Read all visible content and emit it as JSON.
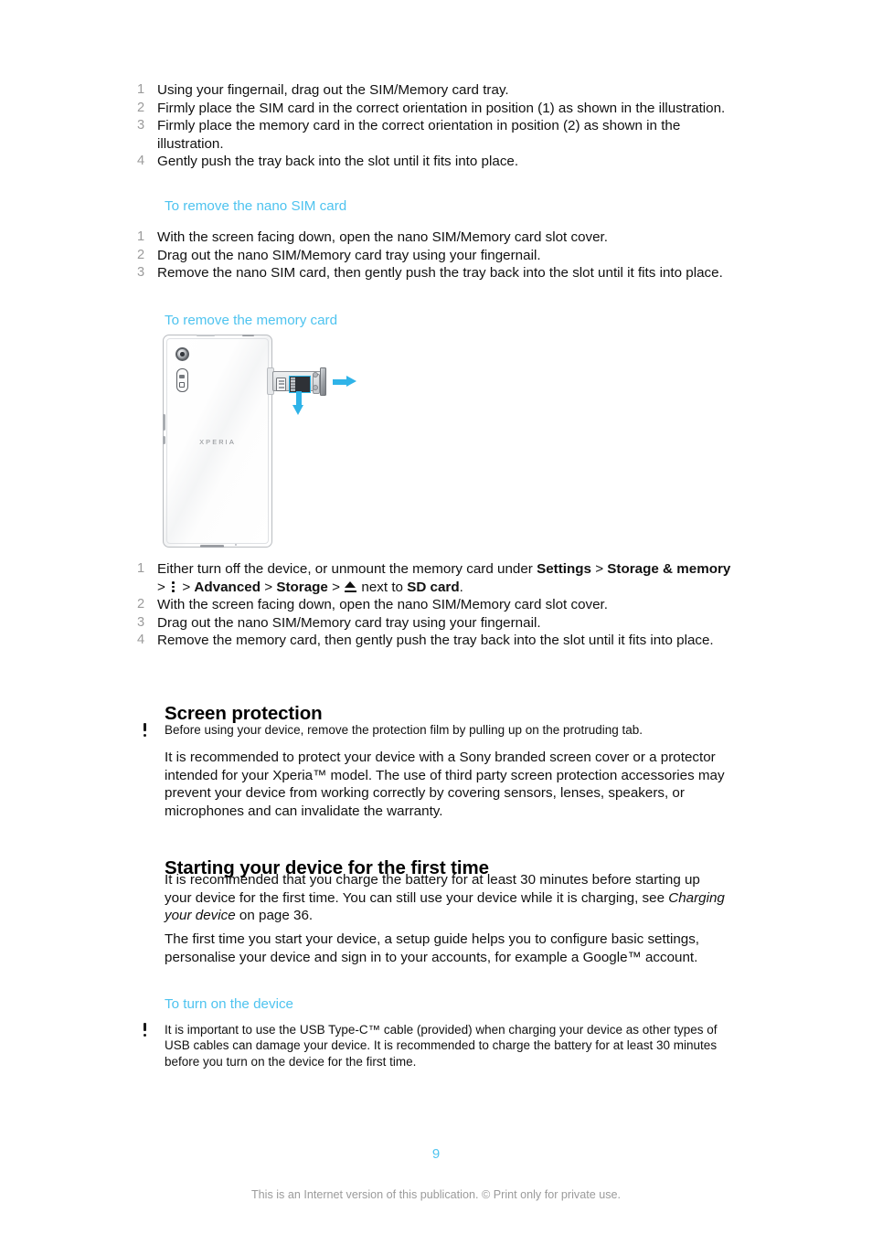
{
  "document": {
    "page_number": "9",
    "footer_note": "This is an Internet version of this publication. © Print only for private use.",
    "accent_color": "#4ec3ef",
    "number_color": "#9b9b9b"
  },
  "insert_steps": {
    "items": [
      {
        "num": "1",
        "text": "Using your fingernail, drag out the SIM/Memory card tray."
      },
      {
        "num": "2",
        "text": "Firmly place the SIM card in the correct orientation in position (1) as shown in the illustration."
      },
      {
        "num": "3",
        "text": "Firmly place the memory card in the correct orientation in position (2) as shown in the illustration."
      },
      {
        "num": "4",
        "text": "Gently push the tray back into the slot until it fits into place."
      }
    ]
  },
  "remove_sim": {
    "heading": "To remove the nano SIM card",
    "items": [
      {
        "num": "1",
        "text": "With the screen facing down, open the nano SIM/Memory card slot cover."
      },
      {
        "num": "2",
        "text": "Drag out the nano SIM/Memory card tray using your fingernail."
      },
      {
        "num": "3",
        "text": "Remove the nano SIM card, then gently push the tray back into the slot until it fits into place."
      }
    ]
  },
  "remove_memory": {
    "heading": "To remove the memory card",
    "step1": {
      "num": "1",
      "part1": "Either turn off the device, or unmount the memory card under ",
      "bold1": "Settings",
      "sep1": " > ",
      "bold2": "Storage & memory",
      "sep2": " > ",
      "icon_kebab": "overflow-menu-icon",
      "sep3": " > ",
      "bold3": "Advanced",
      "sep4": " > ",
      "bold4": "Storage",
      "sep5": " > ",
      "icon_eject": "eject-icon",
      "sep6": " next to ",
      "bold5": "SD card",
      "end": "."
    },
    "items": [
      {
        "num": "2",
        "text": "With the screen facing down, open the nano SIM/Memory card slot cover."
      },
      {
        "num": "3",
        "text": "Drag out the nano SIM/Memory card tray using your fingernail."
      },
      {
        "num": "4",
        "text": "Remove the memory card, then gently push the tray back into the slot until it fits into place."
      }
    ]
  },
  "illustration": {
    "brand_text": "XPERIA",
    "alt": "Back of Xperia phone with nano SIM/Memory card tray pulled out, cyan arrows showing tray removal direction and memory card removal direction",
    "highlight_color": "#29b6e8",
    "arrow_color": "#2fb3e8"
  },
  "screen_protection": {
    "heading": "Screen protection",
    "note": "Before using your device, remove the protection film by pulling up on the protruding tab.",
    "paragraph": "It is recommended to protect your device with a Sony branded screen cover or a protector intended for your Xperia™ model. The use of third party screen protection accessories may prevent your device from working correctly by covering sensors, lenses, speakers, or microphones and can invalidate the warranty."
  },
  "starting_device": {
    "heading": "Starting your device for the first time",
    "para1_before": "It is recommended that you charge the battery for at least 30 minutes before starting up your device for the first time. You can still use your device while it is charging, see ",
    "para1_italic": "Charging your device",
    "para1_after": " on page 36.",
    "para2": "The first time you start your device, a setup guide helps you to configure basic settings, personalise your device and sign in to your accounts, for example a Google™ account.",
    "subheading": "To turn on the device",
    "note": "It is important to use the USB Type-C™ cable (provided) when charging your device as other types of USB cables can damage your device. It is recommended to charge the battery for at least 30 minutes before you turn on the device for the first time."
  }
}
